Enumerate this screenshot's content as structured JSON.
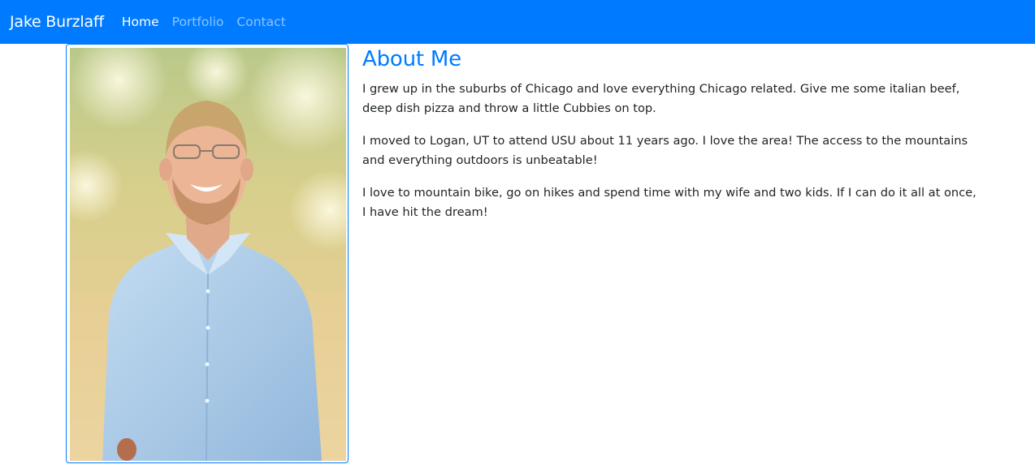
{
  "navbar": {
    "brand": "Jake Burzlaff",
    "links": [
      {
        "label": "Home",
        "active": true
      },
      {
        "label": "Portfolio",
        "active": false
      },
      {
        "label": "Contact",
        "active": false
      }
    ]
  },
  "colors": {
    "primary": "#007bff",
    "text": "#212529",
    "shirt": "#a9cbe8"
  },
  "about": {
    "title": "About Me",
    "paragraphs": [
      "I grew up in the suburbs of Chicago and love everything Chicago related. Give me some italian beef, deep dish pizza and throw a little Cubbies on top.",
      "I moved to Logan, UT to attend USU about 11 years ago. I love the area! The access to the mountains and everything outdoors is unbeatable!",
      "I love to mountain bike, go on hikes and spend time with my wife and two kids. If I can do it all at once, I have hit the dream!"
    ]
  }
}
